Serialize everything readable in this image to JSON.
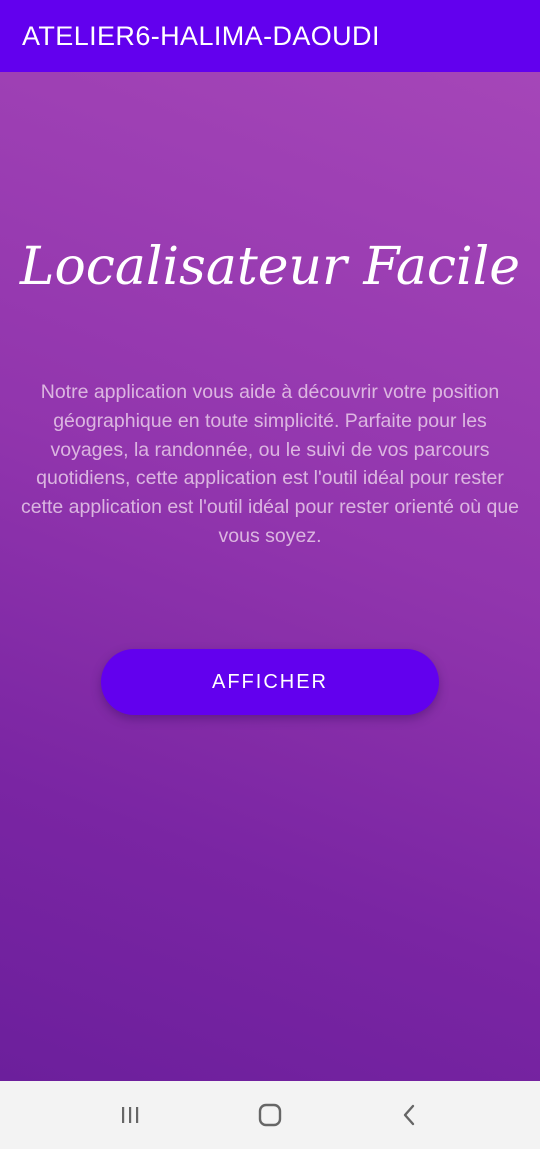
{
  "appbar": {
    "title": "ATELIER6-HALIMA-DAOUDI",
    "color": "#6200EE"
  },
  "main": {
    "headline": "Localisateur Facile",
    "description": "Notre application vous aide à découvrir votre position géographique en toute simplicité. Parfaite pour les voyages, la randonnée, ou le suivi de vos parcours quotidiens, cette application est l'outil idéal pour rester cette application est l'outil idéal pour rester orienté où que vous soyez.",
    "button_label": "AFFICHER",
    "button_color": "#6200EE",
    "background_top": "#a546b8",
    "background_bottom": "#6c1f9c"
  },
  "navbar": {
    "icons": [
      "recent-apps-icon",
      "home-icon",
      "back-icon"
    ]
  }
}
